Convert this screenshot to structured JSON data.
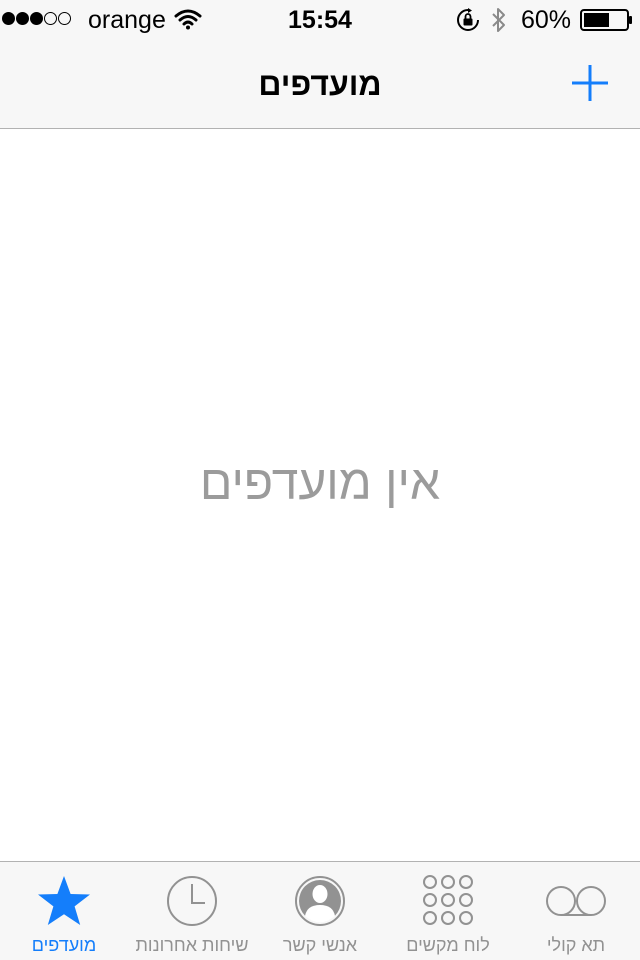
{
  "status_bar": {
    "signal_strength": 3,
    "signal_max": 5,
    "carrier": "orange",
    "time": "15:54",
    "battery_percent_text": "60%",
    "battery_level": 0.6
  },
  "nav": {
    "title": "מועדפים",
    "add_icon": "plus-icon",
    "accent_color": "#147efb"
  },
  "content": {
    "empty_message": "אין מועדפים"
  },
  "tabs": [
    {
      "label": "מועדפים",
      "icon": "star-icon",
      "active": true
    },
    {
      "label": "שיחות אחרונות",
      "icon": "clock-icon",
      "active": false
    },
    {
      "label": "אנשי קשר",
      "icon": "contact-icon",
      "active": false
    },
    {
      "label": "לוח מקשים",
      "icon": "keypad-icon",
      "active": false
    },
    {
      "label": "תא קולי",
      "icon": "voicemail-icon",
      "active": false
    }
  ]
}
